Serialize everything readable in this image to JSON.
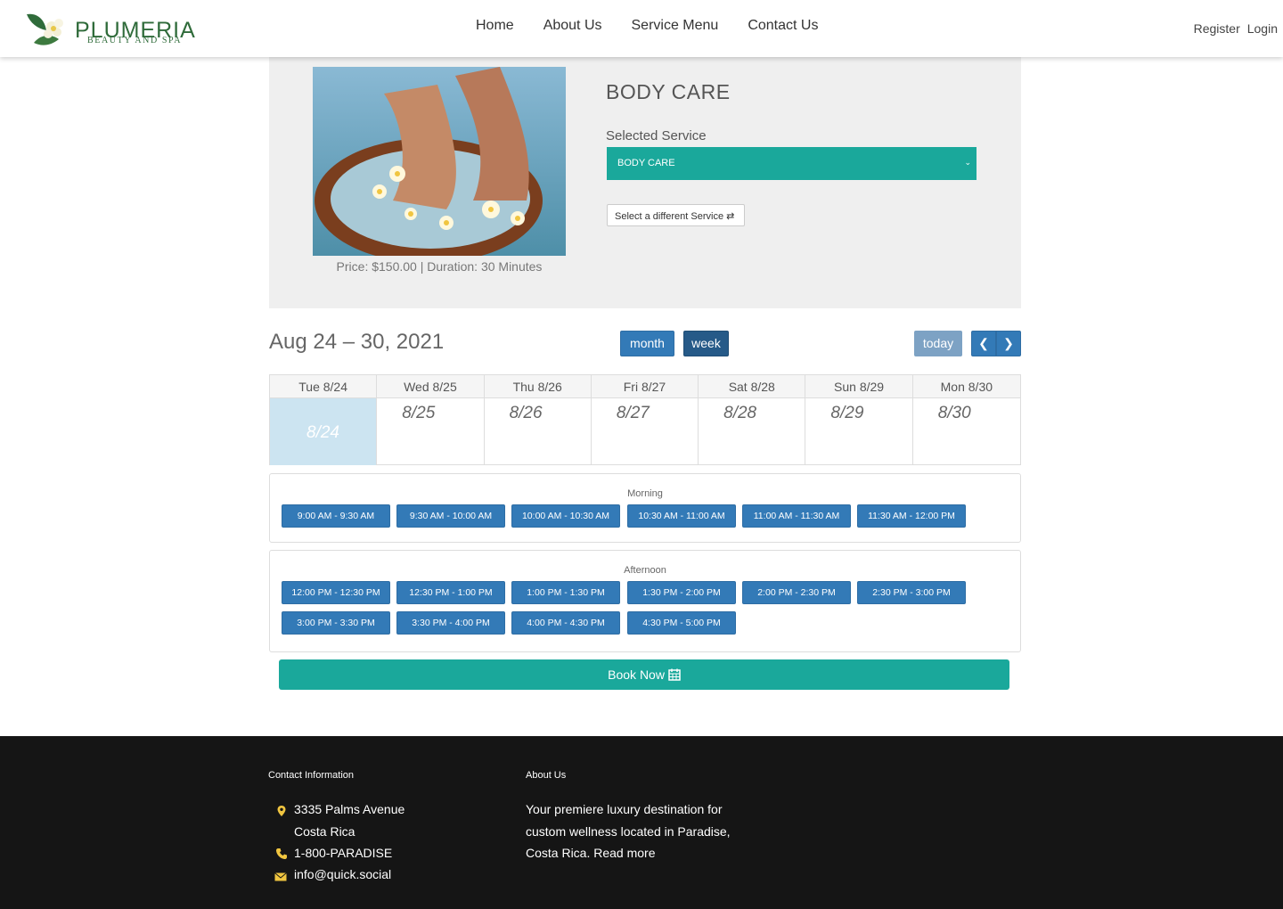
{
  "brand": {
    "name": "PLUMERIA",
    "tagline": "BEAUTY AND SPA"
  },
  "nav": {
    "items": [
      "Home",
      "About Us",
      "Service Menu",
      "Contact Us"
    ]
  },
  "auth": {
    "register": "Register",
    "login": "Login"
  },
  "service": {
    "title": "BODY CARE",
    "selected_label": "Selected Service",
    "selected_value": "BODY CARE",
    "different_button": "Select a different Service",
    "price_line": "Price: $150.00 | Duration: 30 Minutes"
  },
  "calendar": {
    "range_title": "Aug 24 – 30, 2021",
    "views": {
      "month": "month",
      "week": "week",
      "today": "today"
    },
    "days": [
      {
        "head": "Tue 8/24",
        "num": "8/24",
        "today": true
      },
      {
        "head": "Wed 8/25",
        "num": "8/25"
      },
      {
        "head": "Thu 8/26",
        "num": "8/26"
      },
      {
        "head": "Fri 8/27",
        "num": "8/27"
      },
      {
        "head": "Sat 8/28",
        "num": "8/28"
      },
      {
        "head": "Sun 8/29",
        "num": "8/29"
      },
      {
        "head": "Mon 8/30",
        "num": "8/30"
      }
    ]
  },
  "slots": {
    "morning_title": "Morning",
    "morning": [
      "9:00 AM - 9:30 AM",
      "9:30 AM - 10:00 AM",
      "10:00 AM - 10:30 AM",
      "10:30 AM - 11:00 AM",
      "11:00 AM - 11:30 AM",
      "11:30 AM - 12:00 PM"
    ],
    "afternoon_title": "Afternoon",
    "afternoon": [
      "12:00 PM - 12:30 PM",
      "12:30 PM - 1:00 PM",
      "1:00 PM - 1:30 PM",
      "1:30 PM - 2:00 PM",
      "2:00 PM - 2:30 PM",
      "2:30 PM - 3:00 PM",
      "3:00 PM - 3:30 PM",
      "3:30 PM - 4:00 PM",
      "4:00 PM - 4:30 PM",
      "4:30 PM - 5:00 PM"
    ]
  },
  "book_button": "Book Now",
  "footer": {
    "contact_heading": "Contact Information",
    "address1": "3335 Palms Avenue",
    "address2": "Costa Rica",
    "phone": "1-800-PARADISE",
    "email": "info@quick.social",
    "about_heading": "About Us",
    "about_lines": [
      "Your premiere luxury destination for",
      "custom wellness located in Paradise,",
      "Costa Rica. Read more"
    ]
  },
  "colors": {
    "teal": "#1aa89b",
    "blue": "#337ab7",
    "footer_bg": "#151515",
    "brand_green": "#2f6b3a"
  }
}
